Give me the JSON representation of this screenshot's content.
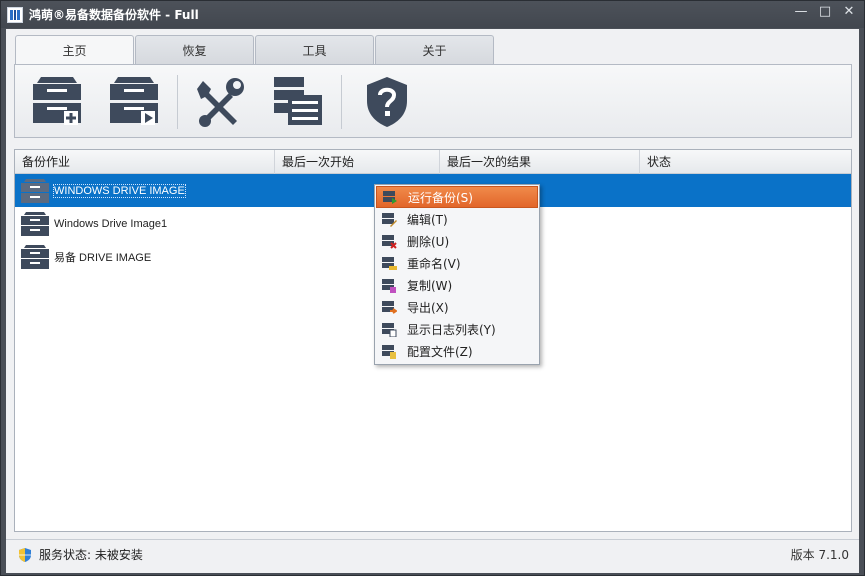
{
  "window": {
    "title": "鸿萌®易备数据备份软件 - Full",
    "minimize_glyph": "—",
    "maximize_glyph": "□",
    "close_glyph": "✕"
  },
  "tabs": [
    {
      "label": "主页",
      "active": true
    },
    {
      "label": "恢复",
      "active": false
    },
    {
      "label": "工具",
      "active": false
    },
    {
      "label": "关于",
      "active": false
    }
  ],
  "ribbon": {
    "buttons": [
      {
        "icon": "new-backup-drive-icon"
      },
      {
        "icon": "run-backup-drive-icon"
      },
      {
        "icon": "tools-icon"
      },
      {
        "icon": "list-log-icon"
      },
      {
        "icon": "help-shield-icon"
      }
    ]
  },
  "list": {
    "columns": [
      "备份作业",
      "最后一次开始",
      "最后一次的结果",
      "状态"
    ],
    "rows": [
      {
        "name": "WINDOWS DRIVE IMAGE",
        "selected": true
      },
      {
        "name": "Windows Drive Image1",
        "selected": false
      },
      {
        "name": "易备 DRIVE IMAGE",
        "selected": false
      }
    ]
  },
  "context_menu": {
    "items": [
      {
        "label": "运行备份(S)",
        "icon": "run-icon",
        "highlighted": true
      },
      {
        "label": "编辑(T)",
        "icon": "edit-icon",
        "highlighted": false
      },
      {
        "label": "删除(U)",
        "icon": "delete-icon",
        "highlighted": false
      },
      {
        "label": "重命名(V)",
        "icon": "rename-icon",
        "highlighted": false
      },
      {
        "label": "复制(W)",
        "icon": "copy-icon",
        "highlighted": false
      },
      {
        "label": "导出(X)",
        "icon": "export-icon",
        "highlighted": false
      },
      {
        "label": "显示日志列表(Y)",
        "icon": "log-list-icon",
        "highlighted": false
      },
      {
        "label": "配置文件(Z)",
        "icon": "config-file-icon",
        "highlighted": false
      }
    ]
  },
  "status": {
    "service_label": "服务状态: 未被安装",
    "version": "版本 7.1.0"
  },
  "colors": {
    "selection": "#0a72c8",
    "menu_highlight": "#e2662a",
    "drive_icon": "#3e4a5c"
  }
}
